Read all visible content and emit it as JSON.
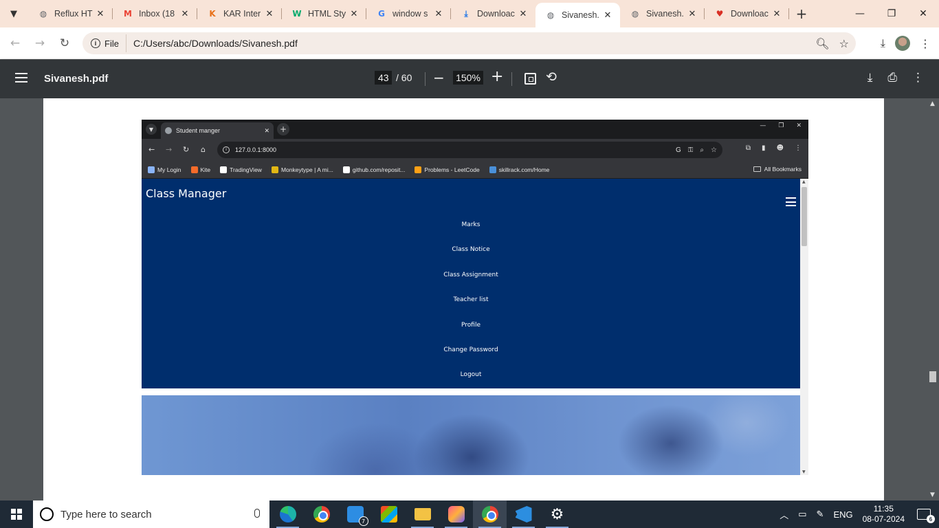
{
  "browser": {
    "tabs": [
      {
        "title": "Reflux HT",
        "icon": "globe-icon",
        "color": "#5f6368"
      },
      {
        "title": "Inbox (18",
        "icon": "gmail-icon",
        "color": "#ea4335"
      },
      {
        "title": "KAR Inter",
        "icon": "kar-icon",
        "color": "#e8711a"
      },
      {
        "title": "HTML Sty",
        "icon": "w3schools-icon",
        "color": "#04aa6d"
      },
      {
        "title": "window s",
        "icon": "google-icon",
        "color": "#4285f4"
      },
      {
        "title": "Downloac",
        "icon": "download-icon",
        "color": "#1a73e8"
      },
      {
        "title": "Sivanesh.",
        "icon": "globe-icon",
        "color": "#5f6368",
        "active": true
      },
      {
        "title": "Sivanesh.",
        "icon": "globe-icon",
        "color": "#5f6368"
      },
      {
        "title": "Downloac",
        "icon": "heart-icon",
        "color": "#d93025"
      }
    ],
    "chip_label": "File",
    "url": "C:/Users/abc/Downloads/Sivanesh.pdf"
  },
  "pdf": {
    "filename": "Sivanesh.pdf",
    "current_page": "43",
    "total_pages": "/ 60",
    "zoom": "150%"
  },
  "shot": {
    "tab_title": "Student manger",
    "url": "127.0.0.1:8000",
    "bookmarks": [
      {
        "label": "My Login",
        "color": "#8ab4f8"
      },
      {
        "label": "Kite",
        "color": "#f56b2a"
      },
      {
        "label": "TradingView",
        "color": "#ffffff"
      },
      {
        "label": "Monkeytype | A mi...",
        "color": "#e2b714"
      },
      {
        "label": "github.com/reposit...",
        "color": "#ffffff"
      },
      {
        "label": "Problems - LeetCode",
        "color": "#ffa116"
      },
      {
        "label": "skillrack.com/Home",
        "color": "#4a90d9"
      }
    ],
    "all_bookmarks": "All Bookmarks",
    "app": {
      "brand": "Class Manager",
      "nav_links": [
        "Marks",
        "Class Notice",
        "Class Assignment",
        "Teacher list",
        "Profile",
        "Change Password",
        "Logout"
      ],
      "nav_color": "#002e6d"
    }
  },
  "taskbar": {
    "search_placeholder": "Type here to search",
    "mail_badge": "7",
    "language": "ENG",
    "time": "11:35",
    "date": "08-07-2024",
    "notification_count": "6"
  }
}
